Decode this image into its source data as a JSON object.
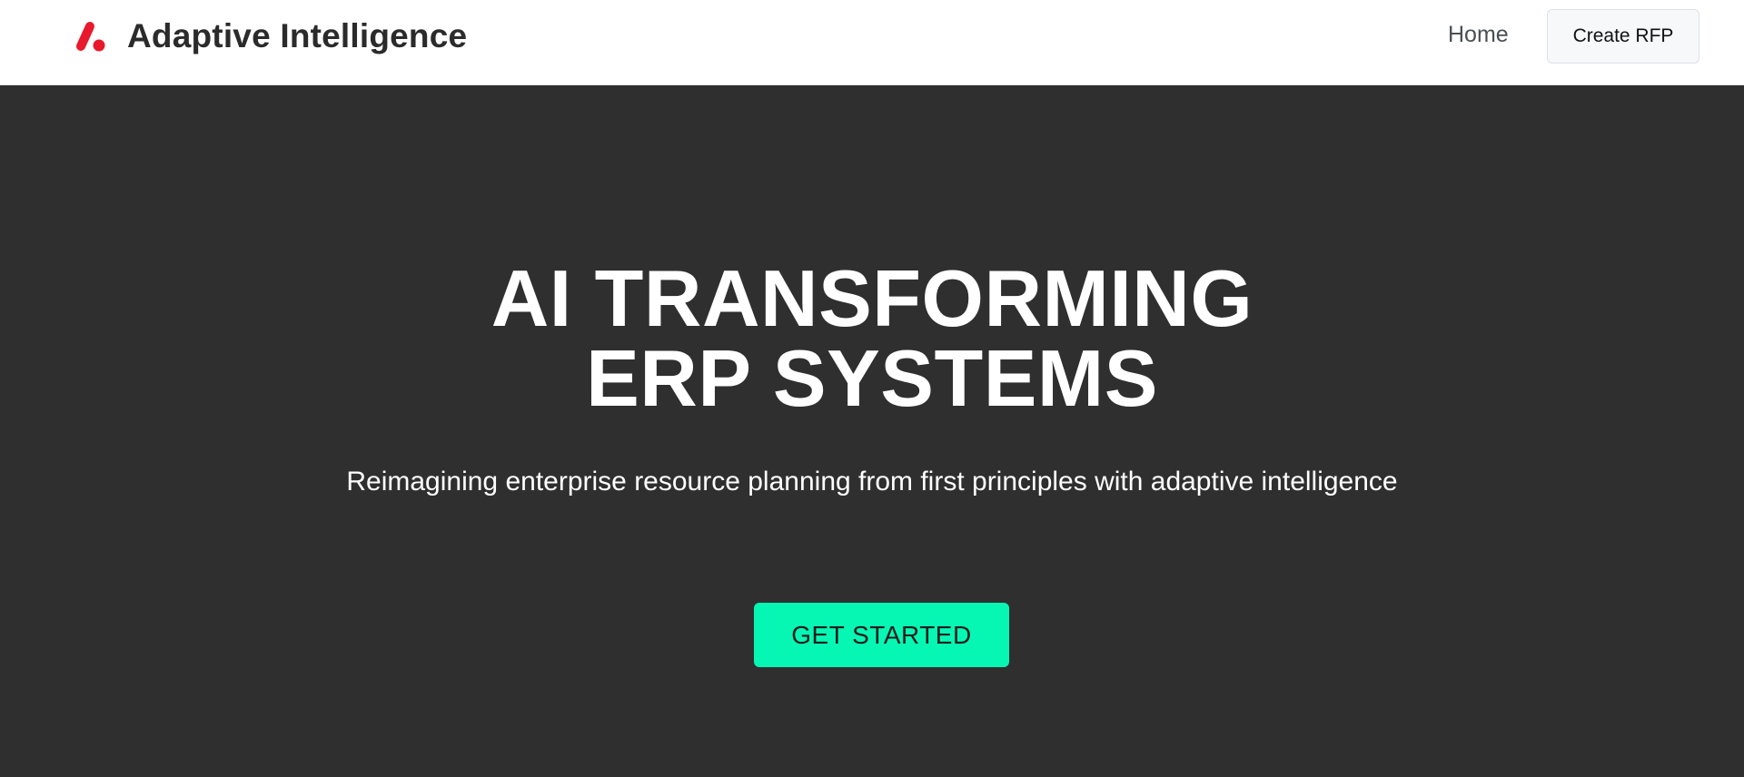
{
  "navbar": {
    "brand_name": "Adaptive Intelligence",
    "logo_icon": "brand-logo-icon",
    "links": {
      "home": "Home"
    },
    "cta_label": "Create RFP"
  },
  "hero": {
    "title_line1": "AI TRANSFORMING",
    "title_line2": "ERP SYSTEMS",
    "subtitle": "Reimagining enterprise resource planning from first principles with adaptive intelligence",
    "cta_label": "GET STARTED"
  },
  "colors": {
    "brand_red": "#e8192c",
    "accent_green": "#06f7b4",
    "hero_background": "#2f2f2f",
    "navbar_background": "#ffffff"
  }
}
